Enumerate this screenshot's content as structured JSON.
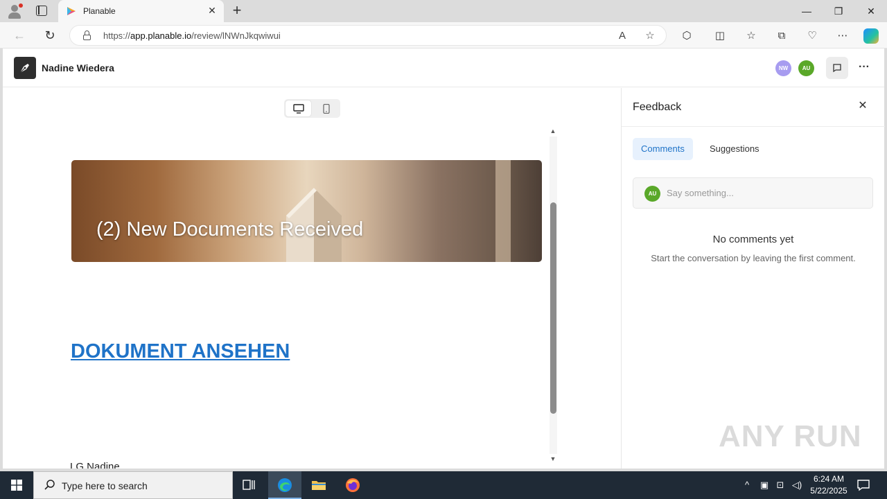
{
  "browser": {
    "tab_title": "Planable",
    "url_scheme": "https://",
    "url_host": "app.planable.io",
    "url_path": "/review/lNWnJkqwiwui"
  },
  "header": {
    "workspace_name": "Nadine Wiedera",
    "avatars": [
      {
        "initials": "NW",
        "color": "#a79cf0"
      },
      {
        "initials": "AU",
        "color": "#5aa829"
      }
    ]
  },
  "preview": {
    "banner_title": "(2) New Documents Received",
    "doc_link": "DOKUMENT ANSEHEN",
    "signoff": "LG Nadine",
    "link_color": "#1f73c8"
  },
  "feedback": {
    "title": "Feedback",
    "tabs": [
      "Comments",
      "Suggestions"
    ],
    "input_avatar": "AU",
    "input_placeholder": "Say something...",
    "empty_title": "No comments yet",
    "empty_subtitle": "Start the conversation by leaving the first comment."
  },
  "watermark": "ANY RUN",
  "taskbar": {
    "search_placeholder": "Type here to search",
    "time": "6:24 AM",
    "date": "5/22/2025"
  }
}
